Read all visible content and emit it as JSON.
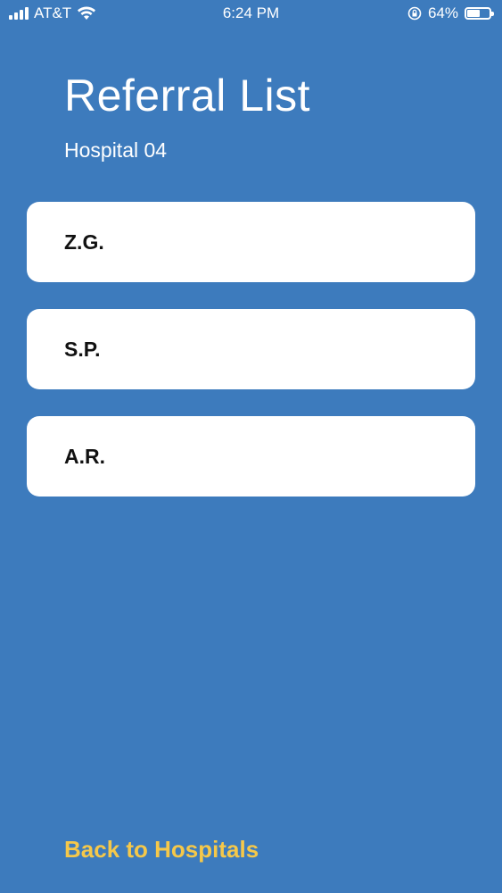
{
  "status_bar": {
    "carrier": "AT&T",
    "time": "6:24 PM",
    "battery_percent": "64%",
    "battery_level": 0.64,
    "icons": [
      "cellular-signal-icon",
      "wifi-icon",
      "orientation-lock-icon",
      "battery-icon"
    ]
  },
  "header": {
    "title": "Referral List",
    "subtitle": "Hospital 04"
  },
  "referrals": [
    {
      "label": "Z.G."
    },
    {
      "label": "S.P."
    },
    {
      "label": "A.R."
    }
  ],
  "footer": {
    "back_label": "Back to Hospitals"
  },
  "colors": {
    "background": "#3d7bbd",
    "card": "#ffffff",
    "accent": "#f5c84a"
  }
}
